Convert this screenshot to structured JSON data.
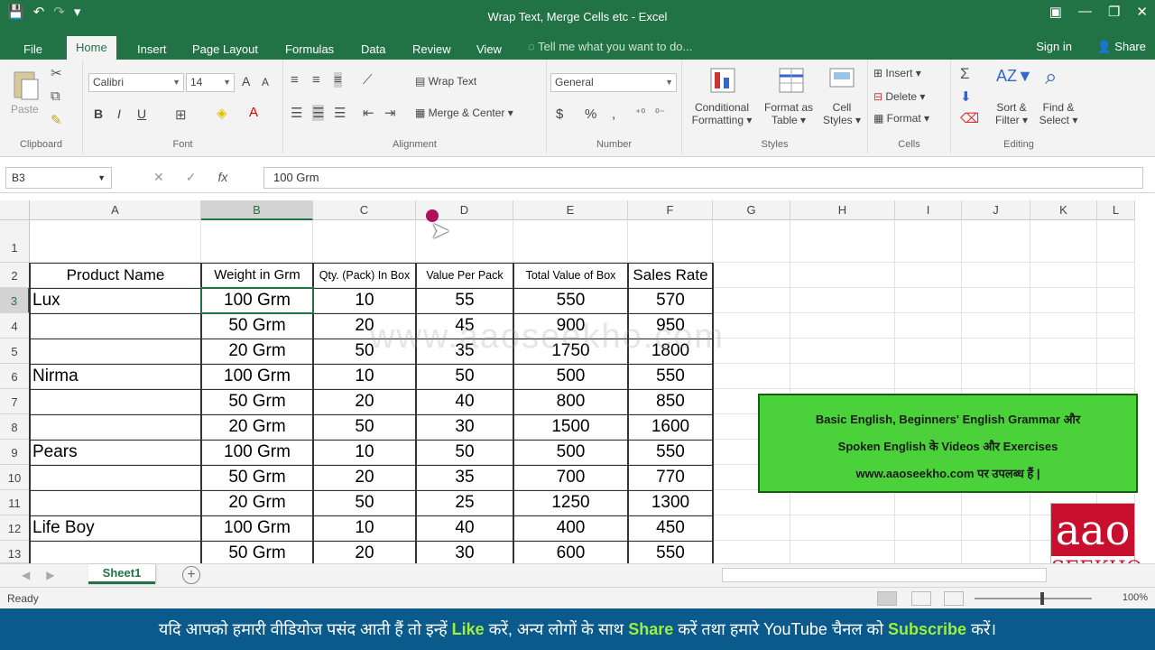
{
  "titlebar": {
    "title": "Wrap Text, Merge Cells etc - Excel",
    "qat_save": "💾",
    "qat_undo": "↶",
    "qat_redo": "↷",
    "qat_more": "▾",
    "ctrl_ribbon": "▣",
    "ctrl_min": "—",
    "ctrl_max": "❐",
    "ctrl_close": "✕"
  },
  "tabs": {
    "file": "File",
    "home": "Home",
    "insert": "Insert",
    "page_layout": "Page Layout",
    "formulas": "Formulas",
    "data": "Data",
    "review": "Review",
    "view": "View",
    "tell_me": "Tell me what you want to do...",
    "sign_in": "Sign in",
    "share": "Share"
  },
  "ribbon": {
    "clipboard": {
      "label": "Clipboard",
      "paste": "Paste"
    },
    "font": {
      "label": "Font",
      "font_name": "Calibri",
      "font_size": "14",
      "bold": "B",
      "italic": "I",
      "underline": "U",
      "grow": "A",
      "shrink": "A"
    },
    "alignment": {
      "label": "Alignment",
      "wrap_text": "Wrap Text",
      "merge_center": "Merge & Center"
    },
    "number": {
      "label": "Number",
      "format": "General",
      "currency": "$",
      "percent": "%",
      "comma": ","
    },
    "styles": {
      "label": "Styles",
      "conditional1": "Conditional",
      "conditional2": "Formatting",
      "format_table1": "Format as",
      "format_table2": "Table",
      "cell_styles1": "Cell",
      "cell_styles2": "Styles"
    },
    "cells": {
      "label": "Cells",
      "insert": "Insert",
      "delete": "Delete",
      "format": "Format"
    },
    "editing": {
      "label": "Editing",
      "sort1": "Sort &",
      "sort2": "Filter",
      "find1": "Find &",
      "find2": "Select"
    }
  },
  "formula_bar": {
    "name_box": "B3",
    "cancel": "✕",
    "enter": "✓",
    "fx": "fx",
    "value": "100 Grm"
  },
  "columns": [
    "A",
    "B",
    "C",
    "D",
    "E",
    "F",
    "G",
    "H",
    "I",
    "J",
    "K",
    "L"
  ],
  "rows": [
    "1",
    "2",
    "3",
    "4",
    "5",
    "6",
    "7",
    "8",
    "9",
    "10",
    "11",
    "12",
    "13"
  ],
  "table": {
    "headers": [
      "Product Name",
      "Weight in Grm",
      "Qty. (Pack) In Box",
      "Value Per Pack",
      "Total Value of Box",
      "Sales Rate"
    ],
    "rows": [
      [
        "Lux",
        "100 Grm",
        "10",
        "55",
        "550",
        "570"
      ],
      [
        "",
        "50 Grm",
        "20",
        "45",
        "900",
        "950"
      ],
      [
        "",
        "20 Grm",
        "50",
        "35",
        "1750",
        "1800"
      ],
      [
        "Nirma",
        "100 Grm",
        "10",
        "50",
        "500",
        "550"
      ],
      [
        "",
        "50 Grm",
        "20",
        "40",
        "800",
        "850"
      ],
      [
        "",
        "20 Grm",
        "50",
        "30",
        "1500",
        "1600"
      ],
      [
        "Pears",
        "100 Grm",
        "10",
        "50",
        "500",
        "550"
      ],
      [
        "",
        "50 Grm",
        "20",
        "35",
        "700",
        "770"
      ],
      [
        "",
        "20 Grm",
        "50",
        "25",
        "1250",
        "1300"
      ],
      [
        "Life Boy",
        "100 Grm",
        "10",
        "40",
        "400",
        "450"
      ],
      [
        "",
        "50 Grm",
        "20",
        "30",
        "600",
        "550"
      ]
    ]
  },
  "watermark": "www.aaoseekho.com",
  "promo": {
    "line1": "Basic English, Beginners' English Grammar और",
    "line2": "Spoken English के Videos और Exercises",
    "line3": "www.aaoseekho.com पर उपलब्ध हैं |"
  },
  "logo": {
    "top": "aao",
    "bottom": "SEEKHO"
  },
  "sheets": {
    "active": "Sheet1",
    "add": "+"
  },
  "status": {
    "ready": "Ready",
    "zoom": "100%"
  },
  "banner": {
    "part1": "यदि आपको हमारी वीडियोज पसंद आती हैं तो इन्हें ",
    "like": "Like",
    "part2": " करें, अन्य लोगों के साथ ",
    "share": "Share",
    "part3": " करें तथा हमारे YouTube चैनल को ",
    "subscribe": "Subscribe",
    "part4": " करें।"
  }
}
